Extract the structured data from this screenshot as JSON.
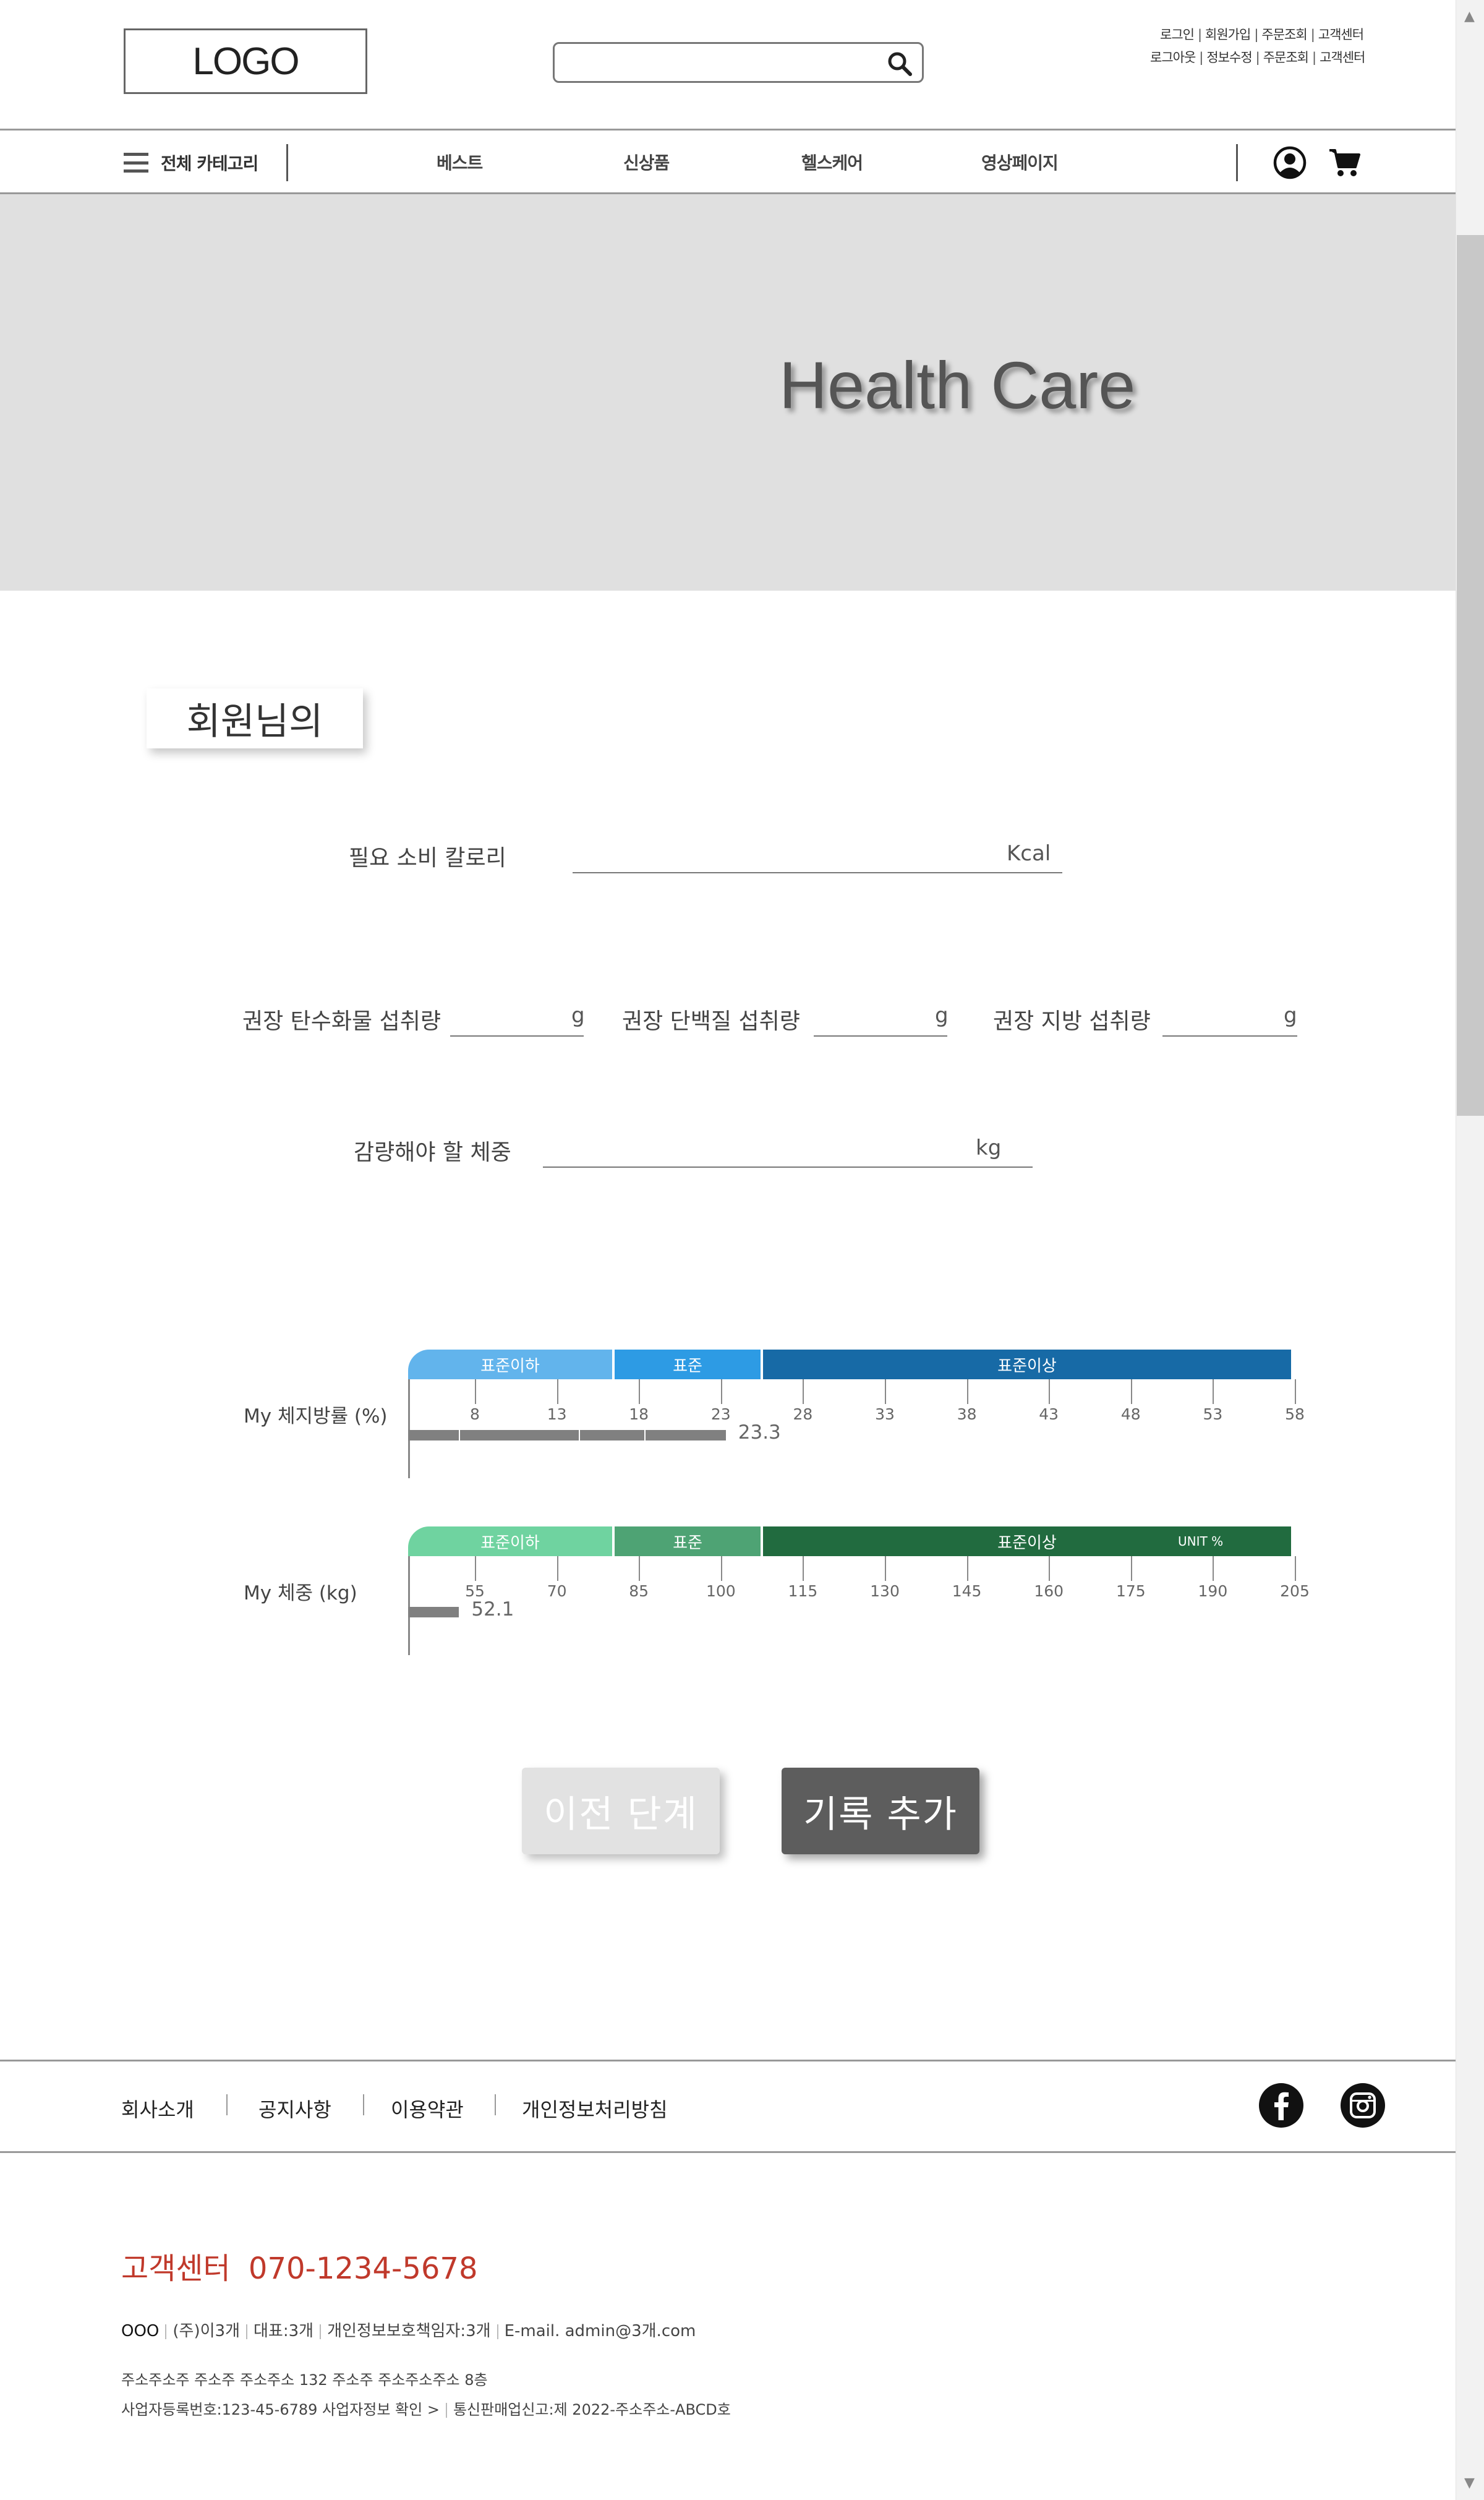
{
  "header": {
    "logo": "LOGO",
    "search": {
      "placeholder": "",
      "value": ""
    },
    "util_row1": [
      "로그인",
      "회원가입",
      "주문조회",
      "고객센터"
    ],
    "util_row2": [
      "로그아웃",
      "정보수정",
      "주문조회",
      "고객센터"
    ]
  },
  "nav": {
    "all_categories": "전체 카테고리",
    "items": [
      "베스트",
      "신상품",
      "헬스케어",
      "영상페이지"
    ]
  },
  "hero": {
    "title": "Health Care"
  },
  "member": {
    "badge": "회원님의",
    "calorie": {
      "label": "필요 소비 칼로리",
      "value": "",
      "unit": "Kcal"
    },
    "carb": {
      "label": "권장 탄수화물 섭취량",
      "value": "",
      "unit": "g"
    },
    "protein": {
      "label": "권장 단백질 섭취량",
      "value": "",
      "unit": "g"
    },
    "fat": {
      "label": "권장 지방 섭취량",
      "value": "",
      "unit": "g"
    },
    "weight_loss": {
      "label": "감량해야 할 체중",
      "value": "",
      "unit": "kg"
    }
  },
  "chart_data": [
    {
      "type": "bar",
      "label": "My 체지방률 (%)",
      "bands": [
        {
          "name": "표준이하",
          "color": "#62b4ec"
        },
        {
          "name": "표준",
          "color": "#2d9be4"
        },
        {
          "name": "표준이상",
          "color": "#176aa6"
        }
      ],
      "ticks": [
        8,
        13,
        18,
        23,
        28,
        33,
        38,
        43,
        48,
        53,
        58
      ],
      "value": 23.3,
      "value_label": "23.3"
    },
    {
      "type": "bar",
      "label": "My 체중 (kg)",
      "bands": [
        {
          "name": "표준이하",
          "color": "#6fd3a0"
        },
        {
          "name": "표준",
          "color": "#4ea374"
        },
        {
          "name": "표준이상",
          "color": "#216b3f"
        }
      ],
      "unit_note": "UNIT %",
      "ticks": [
        55,
        70,
        85,
        100,
        115,
        130,
        145,
        160,
        175,
        190,
        205
      ],
      "value": 52.1,
      "value_label": "52.1"
    }
  ],
  "buttons": {
    "prev": "이전 단계",
    "add": "기록 추가"
  },
  "footer": {
    "links": [
      "회사소개",
      "공지사항",
      "이용약관",
      "개인정보처리방침"
    ],
    "cs_label": "고객센터",
    "cs_phone": "070-1234-5678",
    "company_line1": [
      "OOO",
      "(주)이3개",
      "대표:3개",
      "개인정보보호책임자:3개",
      "E-mail. admin@3개.com"
    ],
    "company_line2": "주소주소주 주소주 주소주소 132 주소주 주소주소주소 8층",
    "company_line3": [
      "사업자등록번호:123-45-6789 사업자정보 확인 >",
      "통신판매업신고:제 2022-주소주소-ABCD호"
    ],
    "social": {
      "facebook": "facebook-icon",
      "instagram": "instagram-icon"
    }
  }
}
